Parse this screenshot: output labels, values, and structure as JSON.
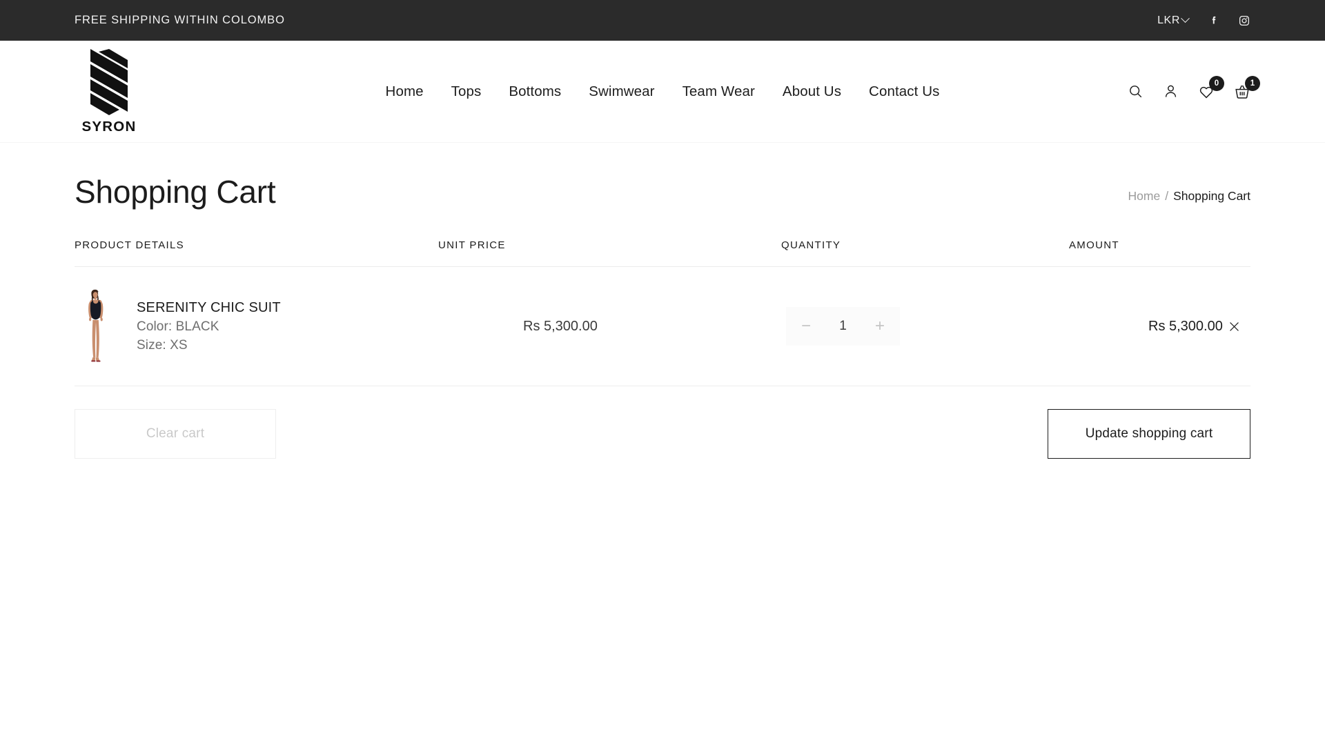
{
  "announcement": {
    "text": "FREE SHIPPING WITHIN COLOMBO",
    "currency": "LKR",
    "currency_icon": "chevron-down-icon",
    "social": [
      {
        "name": "facebook-icon",
        "label": "Facebook"
      },
      {
        "name": "instagram-icon",
        "label": "Instagram"
      }
    ]
  },
  "header": {
    "logo_text": "SYRON",
    "nav": [
      {
        "label": "Home"
      },
      {
        "label": "Tops"
      },
      {
        "label": "Bottoms"
      },
      {
        "label": "Swimwear"
      },
      {
        "label": "Team Wear"
      },
      {
        "label": "About Us"
      },
      {
        "label": "Contact Us"
      }
    ],
    "actions": {
      "search_icon": "search-icon",
      "account_icon": "user-icon",
      "wishlist_icon": "heart-icon",
      "wishlist_count": "0",
      "cart_icon": "basket-icon",
      "cart_count": "1"
    }
  },
  "page": {
    "title": "Shopping Cart",
    "breadcrumb": {
      "home": "Home",
      "separator": "/",
      "current": "Shopping Cart"
    }
  },
  "cart": {
    "columns": {
      "product": "PRODUCT DETAILS",
      "price": "UNIT PRICE",
      "quantity": "QUANTITY",
      "amount": "AMOUNT"
    },
    "items": [
      {
        "name": "SERENITY CHIC SUIT",
        "color": "Color: BLACK",
        "size": "Size: XS",
        "unit_price": "Rs 5,300.00",
        "quantity": "1",
        "amount": "Rs 5,300.00",
        "decrement": "−",
        "increment": "+",
        "remove_icon": "close-icon"
      }
    ],
    "actions": {
      "clear_label": "Clear cart",
      "update_label": "Update shopping cart"
    }
  },
  "colors": {
    "announce_bg": "#2b2b2b",
    "text_primary": "#1c1c1c",
    "text_muted": "#9b9b9b",
    "badge_bg": "#1c1c1c",
    "border": "#ececec"
  }
}
